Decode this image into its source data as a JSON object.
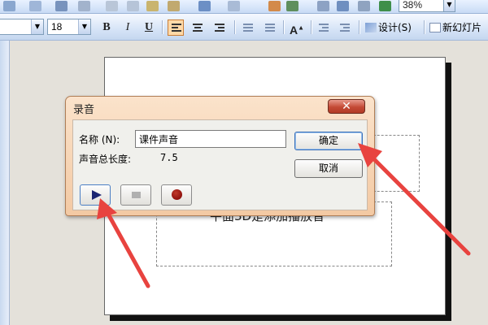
{
  "toolbar": {
    "zoom_value": "38%",
    "font_size": "18",
    "bold_label": "B",
    "italic_label": "I",
    "underline_label": "U",
    "design_label": "设计(S)",
    "new_slide_label": "新幻灯片"
  },
  "dialog": {
    "title": "录音",
    "close_symbol": "✕",
    "name_label": "名称 (N):",
    "name_value": "课件声音",
    "length_label": "声音总长度:",
    "length_value": "7.5",
    "ok_label": "确定",
    "cancel_label": "取消"
  },
  "slide": {
    "visible_text": "平面3D是添加播放音"
  },
  "colors": {
    "annotation_arrow": "#e8433f",
    "active_button": "#ffd9a8",
    "play_icon": "#1a2472",
    "record_icon": "#8b0000"
  },
  "icons": {
    "play": "play-icon",
    "stop": "stop-icon",
    "record": "record-icon",
    "close": "close-icon"
  }
}
